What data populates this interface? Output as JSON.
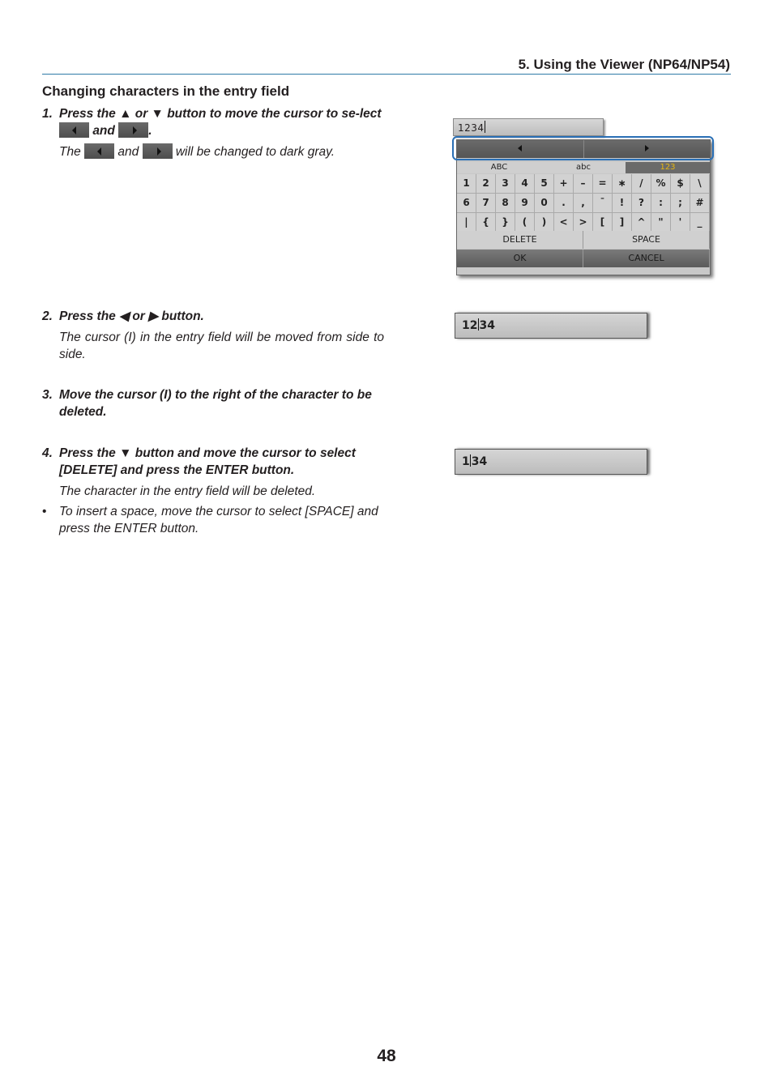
{
  "header": {
    "title": "5. Using the Viewer (NP64/NP54)"
  },
  "section": {
    "title": "Changing characters in the entry field"
  },
  "steps": [
    {
      "number": "1.",
      "instruction_parts": [
        "Press the ▲ or ▼ button to move the cursor to se-lect",
        "and",
        "."
      ],
      "description_parts": [
        "The",
        "and",
        "will be changed to dark gray."
      ]
    },
    {
      "number": "2.",
      "instruction": "Press the ◀ or ▶ button.",
      "description": "The cursor (I) in the entry field will be moved from side to side."
    },
    {
      "number": "3.",
      "instruction": "Move the cursor (I) to the right of the character to be deleted."
    },
    {
      "number": "4.",
      "instruction": "Press the ▼ button and move the cursor to select [DELETE] and press the ENTER button.",
      "description": "The character in the entry field will be deleted.",
      "bullet": "To insert a space, move the cursor to select [SPACE] and press the ENTER button."
    }
  ],
  "keyboard": {
    "field_value": "1234",
    "arrows": {
      "left_icon": "left-arrow-icon",
      "right_icon": "right-arrow-icon"
    },
    "modes": [
      {
        "label": "ABC",
        "active": false
      },
      {
        "label": "abc",
        "active": false
      },
      {
        "label": "123",
        "active": true
      }
    ],
    "keys": [
      [
        "1",
        "2",
        "3",
        "4",
        "5",
        "+",
        "–",
        "=",
        "∗",
        "/",
        "%",
        "$",
        "\\"
      ],
      [
        "6",
        "7",
        "8",
        "9",
        "0",
        ".",
        ",",
        "¯",
        "!",
        "?",
        ":",
        ";",
        "#"
      ],
      [
        "|",
        "{",
        "}",
        "(",
        ")",
        "<",
        ">",
        "[",
        "]",
        "^",
        "\"",
        "'",
        "_"
      ]
    ],
    "delete_label": "DELETE",
    "space_label": "SPACE",
    "ok_label": "OK",
    "cancel_label": "CANCEL",
    "active_mode_color": "#e5b50f",
    "highlight_color": "#2a6fb5"
  },
  "entry_examples": [
    {
      "before_caret": "12",
      "after_caret": "34"
    },
    {
      "before_caret": "1",
      "after_caret": "34"
    }
  ],
  "page_number": "48"
}
